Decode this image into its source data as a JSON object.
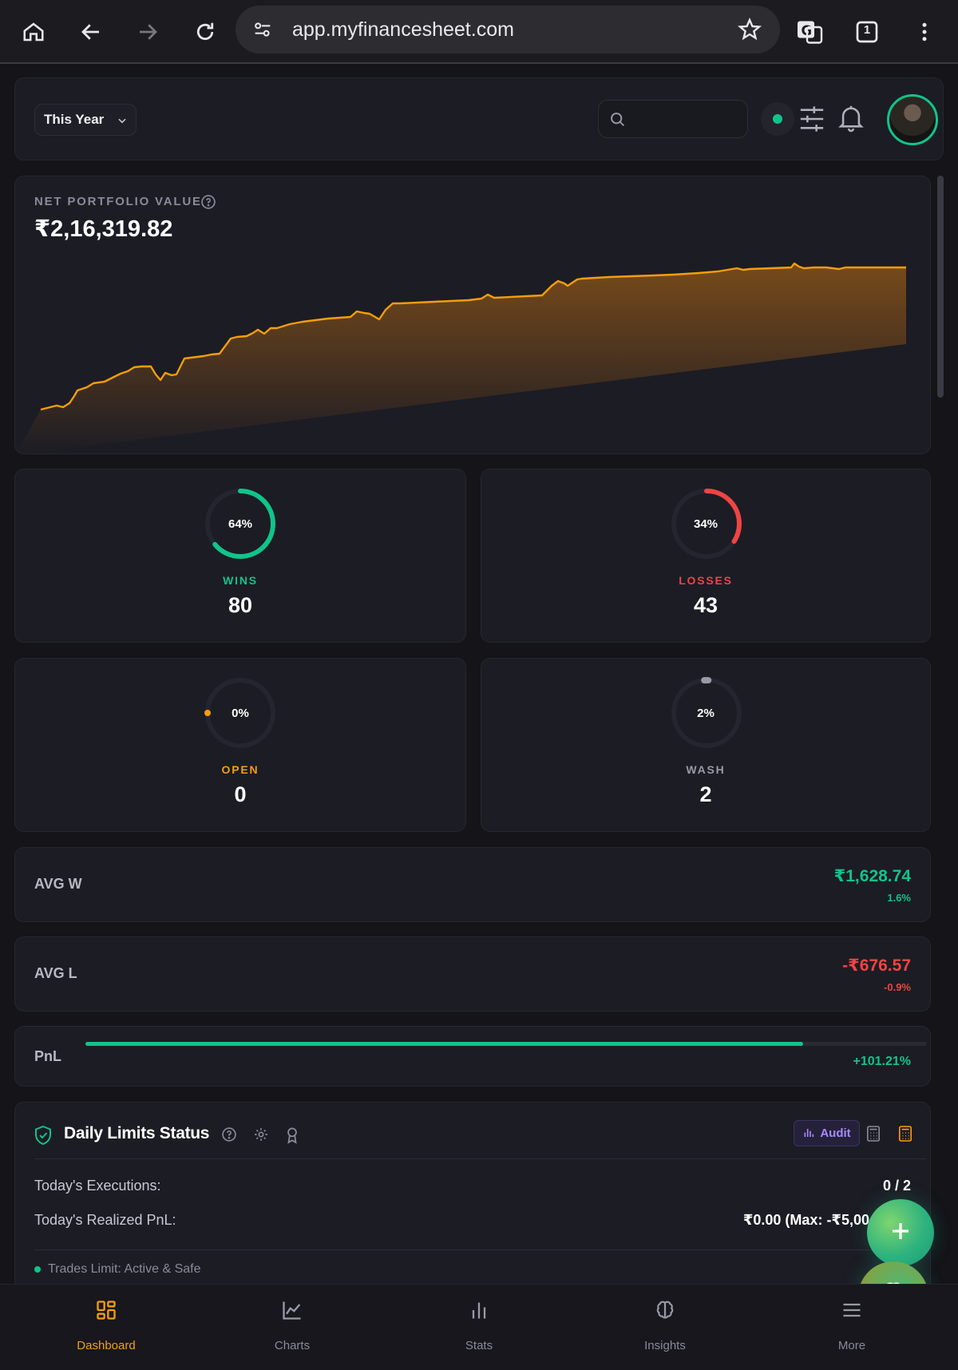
{
  "browser": {
    "url": "app.myfinancesheet.com",
    "tab_count": "1"
  },
  "header": {
    "period": "This Year",
    "search_placeholder": ""
  },
  "portfolio": {
    "label": "NET PORTFOLIO VALUE",
    "value": "₹2,16,319.82"
  },
  "stats": {
    "wins": {
      "label": "WINS",
      "value": "80",
      "pct": "64%",
      "fraction": 0.64,
      "color": "#10c48a"
    },
    "losses": {
      "label": "LOSSES",
      "value": "43",
      "pct": "34%",
      "fraction": 0.34,
      "color": "#ef4444"
    },
    "open": {
      "label": "OPEN",
      "value": "0",
      "pct": "0%",
      "fraction": 0.0,
      "color": "#f59e0b"
    },
    "wash": {
      "label": "WASH",
      "value": "2",
      "pct": "2%",
      "fraction": 0.02,
      "color": "#9a9aa6"
    }
  },
  "avg_w": {
    "label": "AVG W",
    "amount": "₹1,628.74",
    "pct": "1.6%"
  },
  "avg_l": {
    "label": "AVG L",
    "amount": "-₹676.57",
    "pct": "-0.9%"
  },
  "pnl": {
    "label": "PnL",
    "pct": "+101.21%",
    "fill_fraction": 0.853
  },
  "daily_limits": {
    "title": "Daily Limits Status",
    "audit_label": "Audit",
    "executions_label": "Today's Executions:",
    "executions_value": "0 / 2",
    "realized_label": "Today's Realized PnL:",
    "realized_value": "₹0.00 (Max: -₹5,00",
    "trades_limit": "Trades Limit: Active & Safe"
  },
  "nav": [
    {
      "label": "Dashboard",
      "icon": "dashboard-icon",
      "active": true
    },
    {
      "label": "Charts",
      "icon": "chart-icon",
      "active": false
    },
    {
      "label": "Stats",
      "icon": "stats-icon",
      "active": false
    },
    {
      "label": "Insights",
      "icon": "brain-icon",
      "active": false
    },
    {
      "label": "More",
      "icon": "menu-icon",
      "active": false
    }
  ],
  "colors": {
    "accent": "#f59e0b",
    "positive": "#10c48a",
    "negative": "#ef4444",
    "audit": "#a78bfa"
  }
}
